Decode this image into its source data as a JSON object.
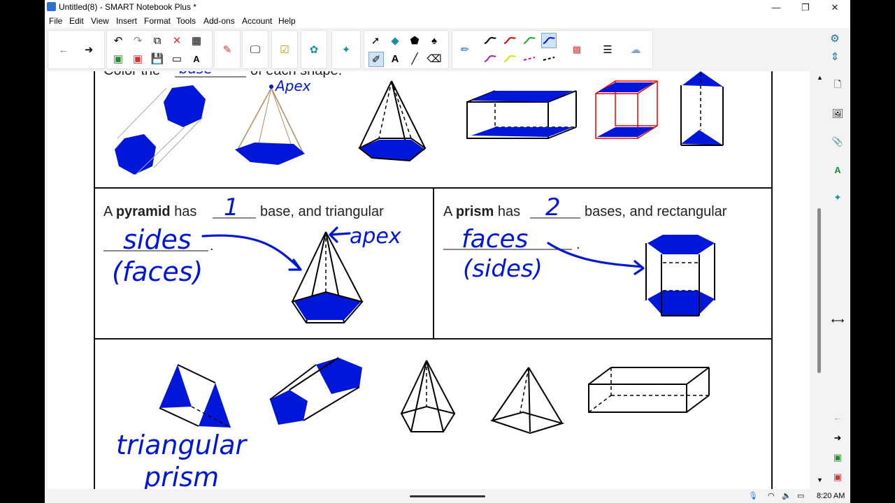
{
  "window": {
    "title": "Untitled(8) - SMART Notebook Plus *"
  },
  "menu": {
    "items": [
      "File",
      "Edit",
      "View",
      "Insert",
      "Format",
      "Tools",
      "Add-ons",
      "Account",
      "Help"
    ]
  },
  "worksheet": {
    "top_text_start": "Color the",
    "top_text_end": "of each shape.",
    "top_blank_answer": "base",
    "apex_label": "Apex",
    "pyramid_sentence": {
      "a": "A",
      "bold": "pyramid",
      "has": "has",
      "rest": "base, and triangular"
    },
    "pyramid_answer_count": "1",
    "pyramid_answer_sides": "sides",
    "pyramid_answer_faces": "(faces)",
    "pyramid_apex_label": "apex",
    "prism_sentence": {
      "a": "A",
      "bold": "prism",
      "has": "has",
      "rest": "bases, and rectangular"
    },
    "prism_answer_count": "2",
    "prism_answer_faces": "faces",
    "prism_answer_sides": "(sides)",
    "bottom_label_1": "triangular",
    "bottom_label_2": "prism",
    "period": "."
  },
  "status": {
    "time": "8:20 AM"
  },
  "colors": {
    "ink": "#0016d8",
    "accent": "#2f6fd0"
  },
  "icons": [
    "back-arrow-icon",
    "forward-arrow-icon",
    "undo-icon",
    "redo-icon",
    "delete-icon",
    "table-icon",
    "select-icon",
    "shapes-icon",
    "eraser-icon",
    "pen-icon",
    "text-icon",
    "line-icon",
    "page-icon",
    "gallery-icon",
    "attachments-icon",
    "properties-icon",
    "addons-icon",
    "microphone-icon",
    "wifi-icon",
    "volume-icon",
    "battery-icon"
  ]
}
